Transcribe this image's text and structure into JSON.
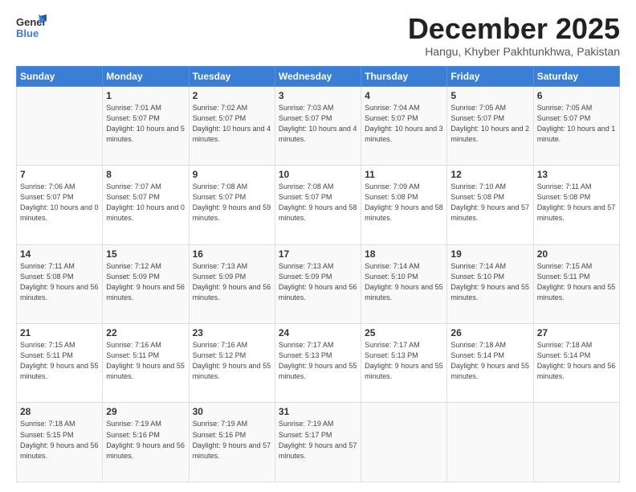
{
  "logo": {
    "general": "General",
    "blue": "Blue"
  },
  "title": {
    "month": "December 2025",
    "location": "Hangu, Khyber Pakhtunkhwa, Pakistan"
  },
  "weekdays": [
    "Sunday",
    "Monday",
    "Tuesday",
    "Wednesday",
    "Thursday",
    "Friday",
    "Saturday"
  ],
  "weeks": [
    [
      {
        "day": "",
        "sunrise": "",
        "sunset": "",
        "daylight": ""
      },
      {
        "day": "1",
        "sunrise": "Sunrise: 7:01 AM",
        "sunset": "Sunset: 5:07 PM",
        "daylight": "Daylight: 10 hours and 5 minutes."
      },
      {
        "day": "2",
        "sunrise": "Sunrise: 7:02 AM",
        "sunset": "Sunset: 5:07 PM",
        "daylight": "Daylight: 10 hours and 4 minutes."
      },
      {
        "day": "3",
        "sunrise": "Sunrise: 7:03 AM",
        "sunset": "Sunset: 5:07 PM",
        "daylight": "Daylight: 10 hours and 4 minutes."
      },
      {
        "day": "4",
        "sunrise": "Sunrise: 7:04 AM",
        "sunset": "Sunset: 5:07 PM",
        "daylight": "Daylight: 10 hours and 3 minutes."
      },
      {
        "day": "5",
        "sunrise": "Sunrise: 7:05 AM",
        "sunset": "Sunset: 5:07 PM",
        "daylight": "Daylight: 10 hours and 2 minutes."
      },
      {
        "day": "6",
        "sunrise": "Sunrise: 7:05 AM",
        "sunset": "Sunset: 5:07 PM",
        "daylight": "Daylight: 10 hours and 1 minute."
      }
    ],
    [
      {
        "day": "7",
        "sunrise": "Sunrise: 7:06 AM",
        "sunset": "Sunset: 5:07 PM",
        "daylight": "Daylight: 10 hours and 0 minutes."
      },
      {
        "day": "8",
        "sunrise": "Sunrise: 7:07 AM",
        "sunset": "Sunset: 5:07 PM",
        "daylight": "Daylight: 10 hours and 0 minutes."
      },
      {
        "day": "9",
        "sunrise": "Sunrise: 7:08 AM",
        "sunset": "Sunset: 5:07 PM",
        "daylight": "Daylight: 9 hours and 59 minutes."
      },
      {
        "day": "10",
        "sunrise": "Sunrise: 7:08 AM",
        "sunset": "Sunset: 5:07 PM",
        "daylight": "Daylight: 9 hours and 58 minutes."
      },
      {
        "day": "11",
        "sunrise": "Sunrise: 7:09 AM",
        "sunset": "Sunset: 5:08 PM",
        "daylight": "Daylight: 9 hours and 58 minutes."
      },
      {
        "day": "12",
        "sunrise": "Sunrise: 7:10 AM",
        "sunset": "Sunset: 5:08 PM",
        "daylight": "Daylight: 9 hours and 57 minutes."
      },
      {
        "day": "13",
        "sunrise": "Sunrise: 7:11 AM",
        "sunset": "Sunset: 5:08 PM",
        "daylight": "Daylight: 9 hours and 57 minutes."
      }
    ],
    [
      {
        "day": "14",
        "sunrise": "Sunrise: 7:11 AM",
        "sunset": "Sunset: 5:08 PM",
        "daylight": "Daylight: 9 hours and 56 minutes."
      },
      {
        "day": "15",
        "sunrise": "Sunrise: 7:12 AM",
        "sunset": "Sunset: 5:09 PM",
        "daylight": "Daylight: 9 hours and 56 minutes."
      },
      {
        "day": "16",
        "sunrise": "Sunrise: 7:13 AM",
        "sunset": "Sunset: 5:09 PM",
        "daylight": "Daylight: 9 hours and 56 minutes."
      },
      {
        "day": "17",
        "sunrise": "Sunrise: 7:13 AM",
        "sunset": "Sunset: 5:09 PM",
        "daylight": "Daylight: 9 hours and 56 minutes."
      },
      {
        "day": "18",
        "sunrise": "Sunrise: 7:14 AM",
        "sunset": "Sunset: 5:10 PM",
        "daylight": "Daylight: 9 hours and 55 minutes."
      },
      {
        "day": "19",
        "sunrise": "Sunrise: 7:14 AM",
        "sunset": "Sunset: 5:10 PM",
        "daylight": "Daylight: 9 hours and 55 minutes."
      },
      {
        "day": "20",
        "sunrise": "Sunrise: 7:15 AM",
        "sunset": "Sunset: 5:11 PM",
        "daylight": "Daylight: 9 hours and 55 minutes."
      }
    ],
    [
      {
        "day": "21",
        "sunrise": "Sunrise: 7:15 AM",
        "sunset": "Sunset: 5:11 PM",
        "daylight": "Daylight: 9 hours and 55 minutes."
      },
      {
        "day": "22",
        "sunrise": "Sunrise: 7:16 AM",
        "sunset": "Sunset: 5:11 PM",
        "daylight": "Daylight: 9 hours and 55 minutes."
      },
      {
        "day": "23",
        "sunrise": "Sunrise: 7:16 AM",
        "sunset": "Sunset: 5:12 PM",
        "daylight": "Daylight: 9 hours and 55 minutes."
      },
      {
        "day": "24",
        "sunrise": "Sunrise: 7:17 AM",
        "sunset": "Sunset: 5:13 PM",
        "daylight": "Daylight: 9 hours and 55 minutes."
      },
      {
        "day": "25",
        "sunrise": "Sunrise: 7:17 AM",
        "sunset": "Sunset: 5:13 PM",
        "daylight": "Daylight: 9 hours and 55 minutes."
      },
      {
        "day": "26",
        "sunrise": "Sunrise: 7:18 AM",
        "sunset": "Sunset: 5:14 PM",
        "daylight": "Daylight: 9 hours and 55 minutes."
      },
      {
        "day": "27",
        "sunrise": "Sunrise: 7:18 AM",
        "sunset": "Sunset: 5:14 PM",
        "daylight": "Daylight: 9 hours and 56 minutes."
      }
    ],
    [
      {
        "day": "28",
        "sunrise": "Sunrise: 7:18 AM",
        "sunset": "Sunset: 5:15 PM",
        "daylight": "Daylight: 9 hours and 56 minutes."
      },
      {
        "day": "29",
        "sunrise": "Sunrise: 7:19 AM",
        "sunset": "Sunset: 5:16 PM",
        "daylight": "Daylight: 9 hours and 56 minutes."
      },
      {
        "day": "30",
        "sunrise": "Sunrise: 7:19 AM",
        "sunset": "Sunset: 5:16 PM",
        "daylight": "Daylight: 9 hours and 57 minutes."
      },
      {
        "day": "31",
        "sunrise": "Sunrise: 7:19 AM",
        "sunset": "Sunset: 5:17 PM",
        "daylight": "Daylight: 9 hours and 57 minutes."
      },
      {
        "day": "",
        "sunrise": "",
        "sunset": "",
        "daylight": ""
      },
      {
        "day": "",
        "sunrise": "",
        "sunset": "",
        "daylight": ""
      },
      {
        "day": "",
        "sunrise": "",
        "sunset": "",
        "daylight": ""
      }
    ]
  ]
}
